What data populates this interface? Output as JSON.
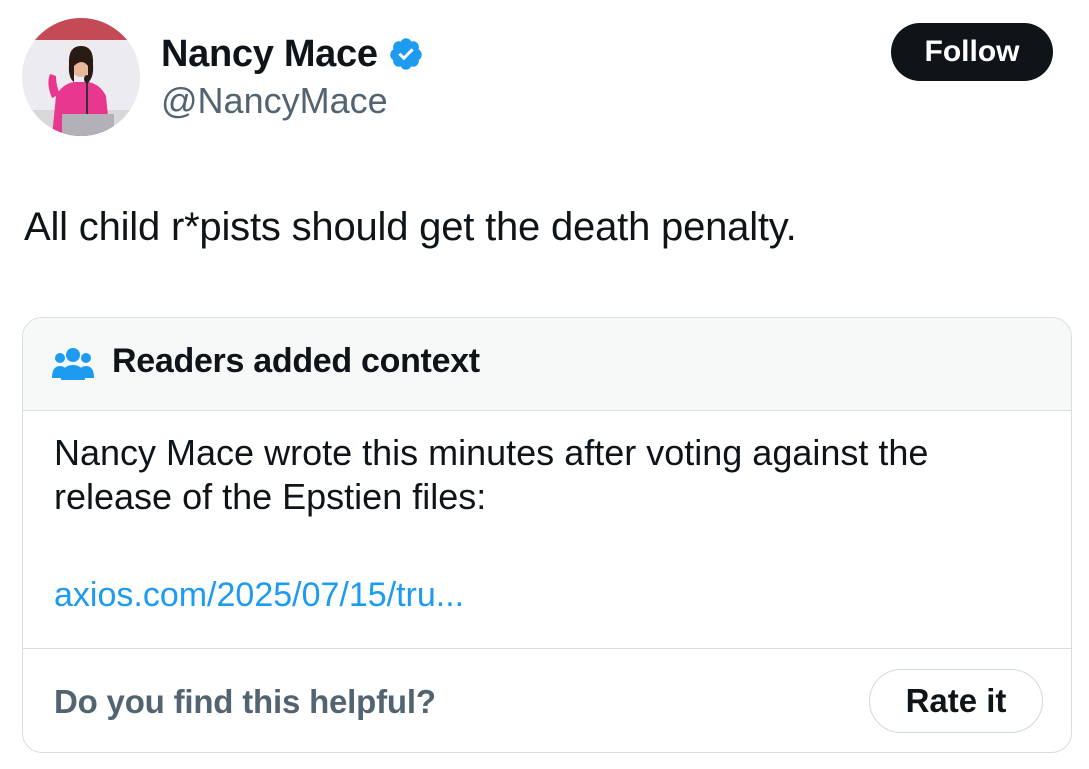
{
  "author": {
    "display_name": "Nancy Mace",
    "handle": "@NancyMace",
    "avatar_icon": "profile-photo",
    "verified_icon": "verified-badge-icon",
    "verified_color": "#1d9bf0"
  },
  "actions": {
    "follow_label": "Follow"
  },
  "tweet": {
    "text": "All child r*pists should get the death penalty."
  },
  "community_note": {
    "header_icon": "people-icon",
    "header_icon_color": "#1d9bf0",
    "title": "Readers added context",
    "body": "Nancy Mace wrote this minutes after voting against the release of the Epstien files:",
    "link_text": "axios.com/2025/07/15/tru...",
    "link_color": "#1d9bf0",
    "helpful_prompt": "Do you find this helpful?",
    "rate_label": "Rate it"
  },
  "colors": {
    "text_primary": "#0f1419",
    "text_secondary": "#536471",
    "border": "#d8dde1",
    "note_header_bg": "#f7f9f9",
    "follow_bg": "#0f1419"
  }
}
